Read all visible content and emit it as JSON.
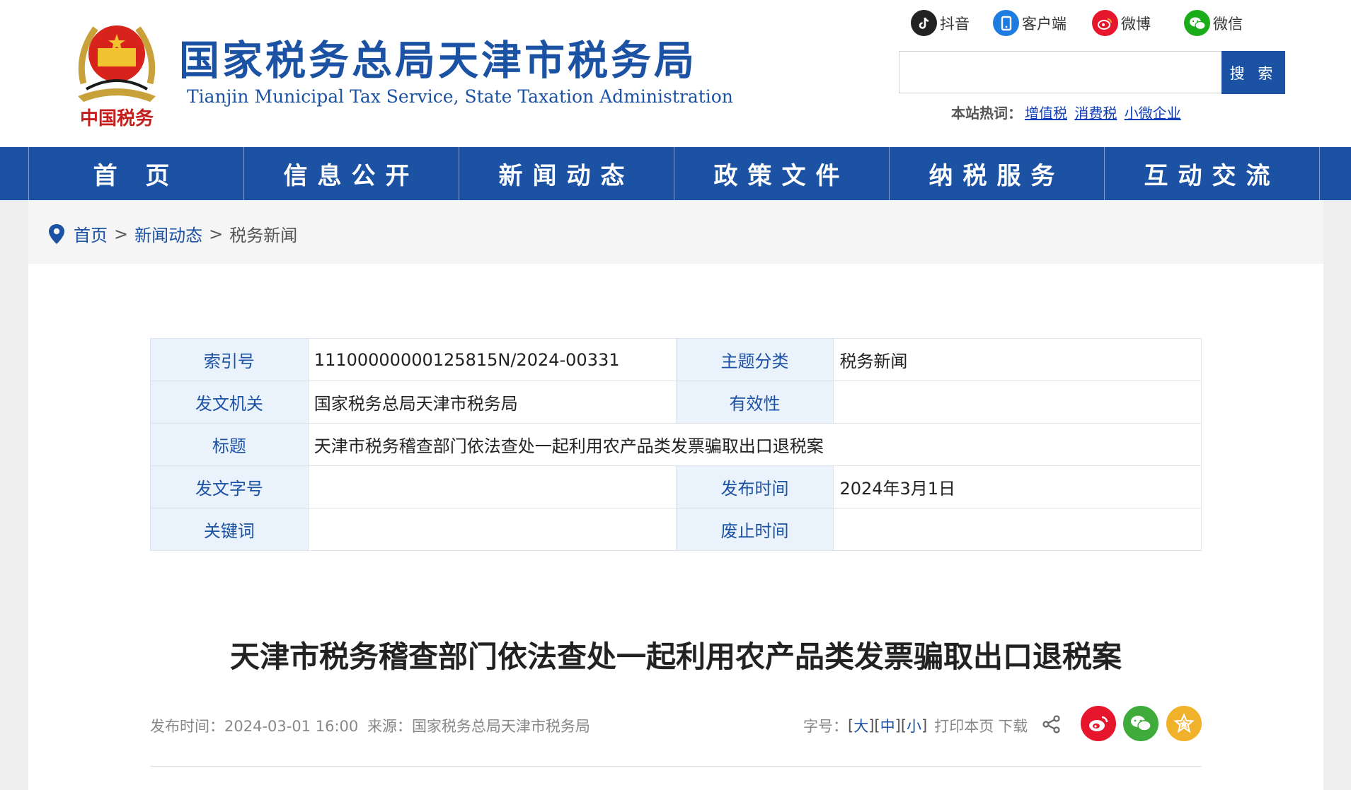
{
  "header": {
    "title_cn": "国家税务总局天津市税务局",
    "title_en": "Tianjin Municipal Tax Service, State Taxation Administration",
    "emblem_text": "中国税务",
    "social": [
      {
        "label": "抖音",
        "icon": "douyin-icon",
        "color": "#222222"
      },
      {
        "label": "客户端",
        "icon": "mobile-app-icon",
        "color": "#1e7be0"
      },
      {
        "label": "微博",
        "icon": "weibo-icon",
        "color": "#e6162d"
      },
      {
        "label": "微信",
        "icon": "wechat-icon",
        "color": "#1aad19"
      }
    ],
    "search": {
      "placeholder": "",
      "button_label": "搜 索"
    },
    "hotwords": {
      "label": "本站热词：",
      "items": [
        "增值税",
        "消费税",
        "小微企业"
      ]
    }
  },
  "nav": {
    "items": [
      "首 页",
      "信息公开",
      "新闻动态",
      "政策文件",
      "纳税服务",
      "互动交流"
    ]
  },
  "breadcrumb": {
    "home": "首页",
    "sep": ">",
    "section": "新闻动态",
    "current": "税务新闻"
  },
  "info_table": {
    "index_label": "索引号",
    "index_value": "11100000000125815N/2024-00331",
    "topic_label": "主题分类",
    "topic_value": "税务新闻",
    "issuer_label": "发文机关",
    "issuer_value": "国家税务总局天津市税务局",
    "validity_label": "有效性",
    "validity_value": "",
    "title_label": "标题",
    "title_value": "天津市税务稽查部门依法查处一起利用农产品类发票骗取出口退税案",
    "docno_label": "发文字号",
    "docno_value": "",
    "pubdate_label": "发布时间",
    "pubdate_value": "2024年3月1日",
    "keywords_label": "关键词",
    "keywords_value": "",
    "expiry_label": "废止时间",
    "expiry_value": ""
  },
  "article": {
    "title": "天津市税务稽查部门依法查处一起利用农产品类发票骗取出口退税案",
    "published_label": "发布时间：",
    "published_value": "2024-03-01 16:00",
    "source_label": "来源：",
    "source_value": "国家税务总局天津市税务局",
    "font_label": "字号：",
    "font_large": "大",
    "font_medium": "中",
    "font_small": "小",
    "print_label": "打印本页",
    "download_label": "下载"
  },
  "share": {
    "icons": [
      "share-icon",
      "weibo-share-icon",
      "wechat-share-icon",
      "favorite-icon"
    ],
    "colors": {
      "weibo": "#e6162d",
      "wechat": "#3fab3a",
      "favorite": "#f0b12b"
    }
  },
  "colors": {
    "brand_blue": "#1c52a3",
    "table_key_bg": "#eaf2fb"
  }
}
